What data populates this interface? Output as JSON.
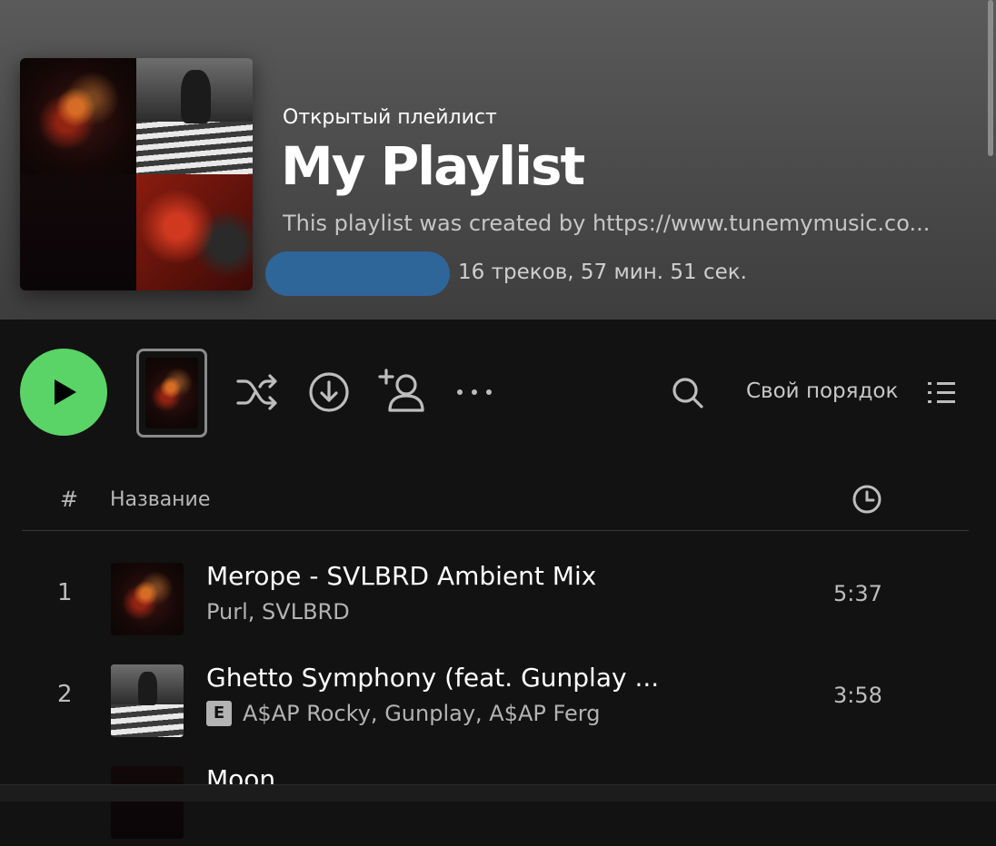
{
  "playlist": {
    "type_label": "Открытый плейлист",
    "title": "My Playlist",
    "description": "This playlist was created by https://www.tunemymusic.co...",
    "meta": "16 треков, 57 мин. 51 сек."
  },
  "controls": {
    "sort_label": "Свой порядок"
  },
  "table": {
    "num_header": "#",
    "title_header": "Название"
  },
  "tracks": [
    {
      "num": "1",
      "name": "Merope - SVLBRD Ambient Mix",
      "artists": "Purl, SVLBRD",
      "duration": "5:37",
      "explicit": false
    },
    {
      "num": "2",
      "name": "Ghetto Symphony (feat. Gunplay ...",
      "artists": "A$AP Rocky, Gunplay, A$AP Ferg",
      "duration": "3:58",
      "explicit": true,
      "explicit_label": "E"
    },
    {
      "num": "",
      "name": "Moon",
      "artists": "",
      "duration": "",
      "explicit": false
    }
  ],
  "icons": [
    "play-icon",
    "shuffle-icon",
    "download-icon",
    "add-user-icon",
    "more-icon",
    "search-icon",
    "list-icon",
    "clock-icon"
  ],
  "colors": {
    "accent": "#5ad466",
    "background": "#121212",
    "owner_pill": "#2f6699"
  }
}
